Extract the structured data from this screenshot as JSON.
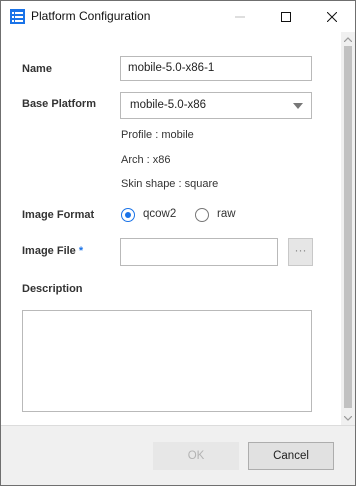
{
  "window": {
    "title": "Platform Configuration",
    "icon": "list-icon",
    "accent_color": "#1a73e8"
  },
  "form": {
    "name_label": "Name",
    "name_value": "mobile-5.0-x86-1",
    "base_platform_label": "Base Platform",
    "base_platform_value": "mobile-5.0-x86",
    "profile_text": "Profile : mobile",
    "arch_text": "Arch : x86",
    "skin_shape_text": "Skin shape : square",
    "image_format_label": "Image Format",
    "image_format_options": [
      "qcow2",
      "raw"
    ],
    "image_format_selected": "qcow2",
    "image_file_label": "Image File",
    "image_file_required_mark": "*",
    "image_file_value": "",
    "browse_label": "···",
    "description_label": "Description",
    "description_value": ""
  },
  "footer": {
    "ok_label": "OK",
    "cancel_label": "Cancel"
  }
}
